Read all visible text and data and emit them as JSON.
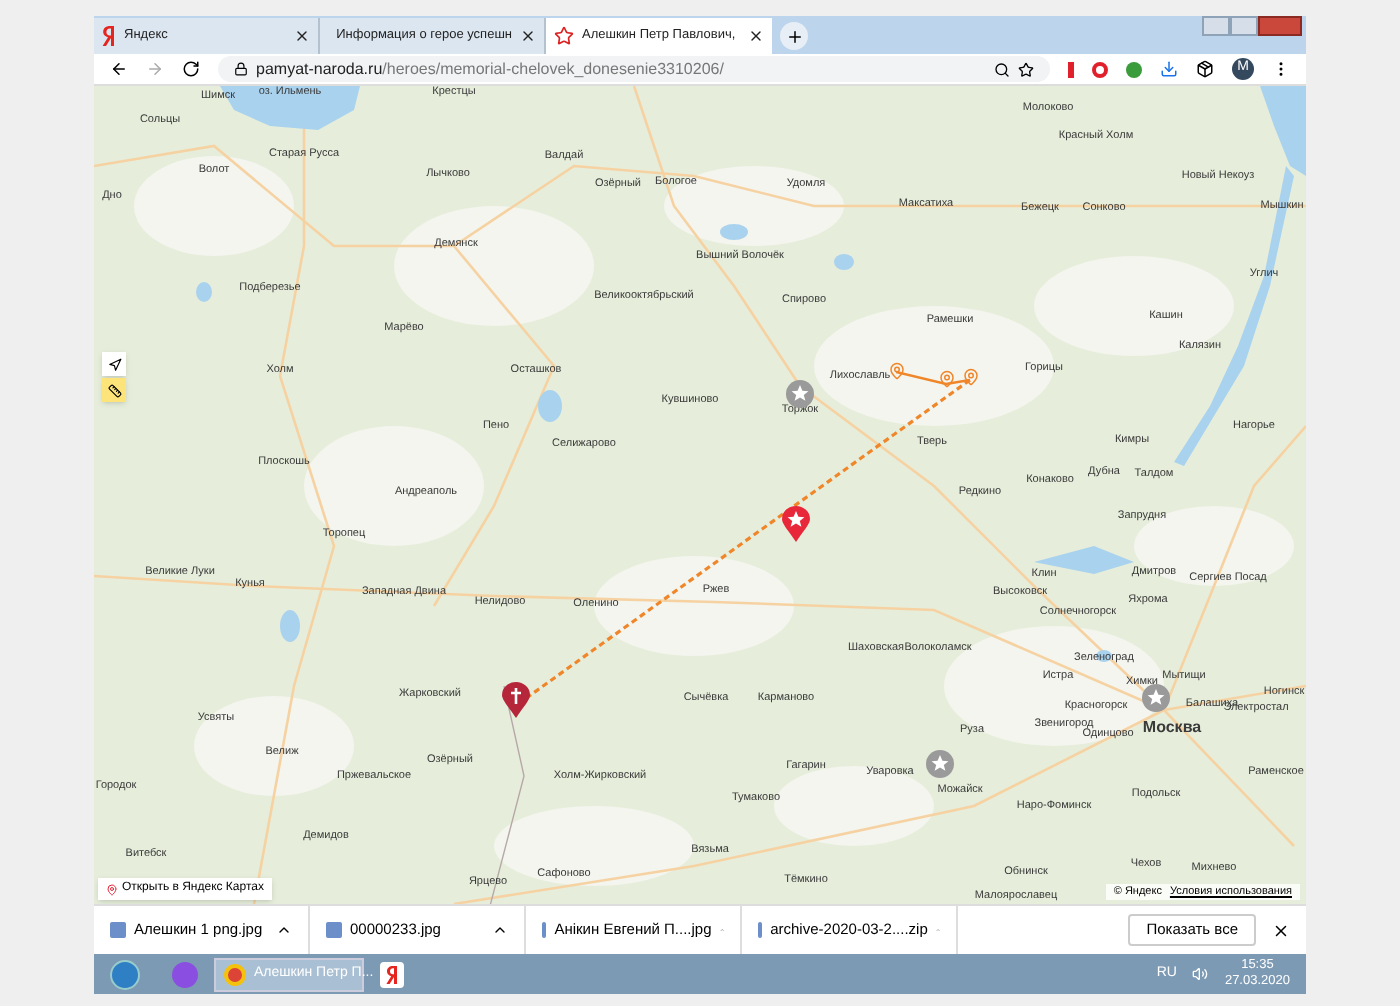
{
  "tabs": [
    {
      "kind": "yandex",
      "label": "Яндекс",
      "selected": false
    },
    {
      "kind": "info",
      "label": "Информация о герое успешн",
      "selected": false
    },
    {
      "kind": "star",
      "label": "Алешкин Петр Павлович,",
      "selected": true
    }
  ],
  "address_bar": {
    "domain": "pamyat-naroda.ru",
    "path": "/heroes/memorial-chelovek_donesenie3310206/"
  },
  "profile": {
    "initial": "M"
  },
  "map": {
    "labels": [
      "Шимск",
      "оз. Ильмень",
      "Крестцы",
      "Сольцы",
      "Старая Русса",
      "Волот",
      "Лычково",
      "Валдай",
      "Озёрный",
      "Бологое",
      "Дно",
      "Демянск",
      "Вышний Волочёк",
      "Подберезье",
      "Великооктябрьский",
      "Марёво",
      "Холм",
      "Осташков",
      "Кувшиново",
      "Пено",
      "Селижарово",
      "Плоскошь",
      "Андреаполь",
      "Молоково",
      "Красный Холм",
      "Удомля",
      "Новый Некоуз",
      "Максатиха",
      "Бежецк",
      "Сонково",
      "Мышкин",
      "Спирово",
      "Углич",
      "Рамешки",
      "Кашин",
      "Калязин",
      "Лихославль",
      "Торжок",
      "Горицы",
      "Тверь",
      "Кимры",
      "Нагорье",
      "Конаково",
      "Дубна",
      "Талдом",
      "Редкино",
      "Торопец",
      "Великие Луки",
      "Кунья",
      "Западная Двина",
      "Нелидово",
      "Оленино",
      "Ржев",
      "Жарковский",
      "Сычёвка",
      "Усвяты",
      "Велиж",
      "Озёрный",
      "Пржевальское",
      "Холм-Жирковский",
      "Городок",
      "Демидов",
      "Вязьма",
      "Витебск",
      "Ярцево",
      "Сафоново",
      "Запрудня",
      "Дмитров",
      "Сергиев Посад",
      "Клин",
      "Высоковск",
      "Яхрома",
      "Солнечногорск",
      "Шаховская",
      "Волоколамск",
      "Зеленоград",
      "Истра",
      "Химки",
      "Мытищи",
      "Ногинск",
      "Красногорск",
      "Москва",
      "Балашиха",
      "Электростал",
      "Карманово",
      "Звенигород",
      "Руза",
      "Одинцово",
      "Гагарин",
      "Уваровка",
      "Можайск",
      "Раменское",
      "Тумаково",
      "Наро-Фоминск",
      "Подольск",
      "Обнинск",
      "Чехов",
      "Тёмкино",
      "Михнево",
      "Малоярославец"
    ],
    "open_button": "Открыть в Яндекс Картах",
    "attribution": "© Яндекс",
    "terms_link": "Условия использования"
  },
  "downloads": {
    "items": [
      "Алешкин 1 png.jpg",
      "00000233.jpg",
      "Анікин Евгений П....jpg",
      "archive-2020-03-2....zip"
    ],
    "show_all": "Показать все"
  },
  "taskbar": {
    "window": "Алешкин Петр П...",
    "language": "RU",
    "time": "15:35",
    "date": "27.03.2020"
  }
}
